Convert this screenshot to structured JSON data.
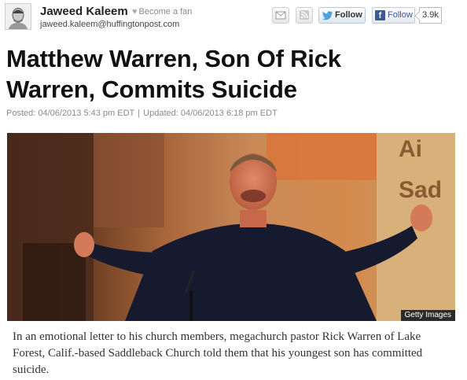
{
  "byline": {
    "author_name": "Jaweed Kaleem",
    "become_fan": "Become a fan",
    "author_email": "jaweed.kaleem@huffingtonpost.com"
  },
  "social": {
    "mail_icon": "envelope-icon",
    "rss_icon": "rss-icon",
    "twitter_label": "Follow",
    "facebook_label": "Follow",
    "facebook_count": "3.9k",
    "colors": {
      "twitter": "#4aa3df",
      "facebook": "#3b5998",
      "rss": "#f79c33"
    }
  },
  "article": {
    "headline": "Matthew Warren, Son Of Rick Warren, Commits Suicide",
    "posted": "Posted: 04/06/2013 5:43 pm EDT",
    "separator": "|",
    "updated": "Updated: 04/06/2013 6:18 pm EDT",
    "photo_credit": "Getty Images",
    "summary": "In an emotional letter to his church members, megachurch pastor Rick Warren of Lake Forest, Calif.-based Saddleback Church told them that his youngest son has committed suicide."
  }
}
